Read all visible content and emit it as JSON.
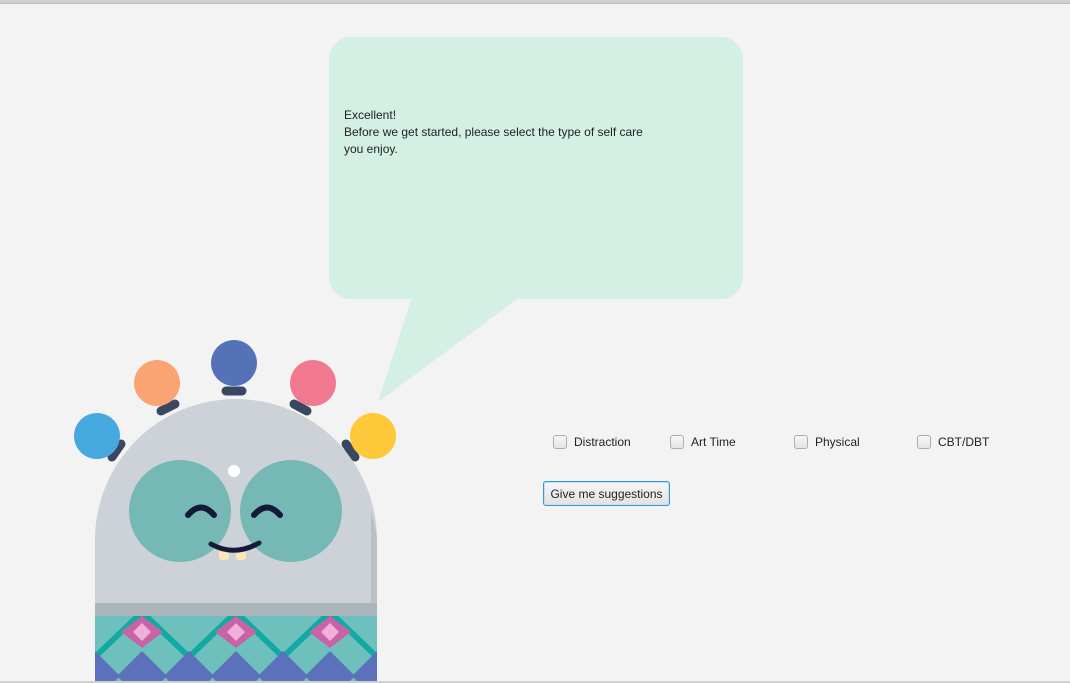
{
  "bubble": {
    "line1": "Excellent!",
    "line2": "Before we get started, please select the type of self care",
    "line3": "you enjoy."
  },
  "options": [
    {
      "label": "Distraction",
      "checked": false
    },
    {
      "label": "Art Time",
      "checked": false
    },
    {
      "label": "Physical",
      "checked": false
    },
    {
      "label": "CBT/DBT",
      "checked": false
    }
  ],
  "suggest_button": {
    "label": "Give me suggestions"
  },
  "colors": {
    "background": "#f3f3f3",
    "bubble": "#d4efe3",
    "button_focus": "#3f93d2",
    "mascot_body": "#cdd2d8",
    "mascot_eyes": "#76b8b6",
    "antenna_colors": [
      "#45a9df",
      "#f9a472",
      "#5572b8",
      "#f07990",
      "#fdc93b"
    ]
  }
}
